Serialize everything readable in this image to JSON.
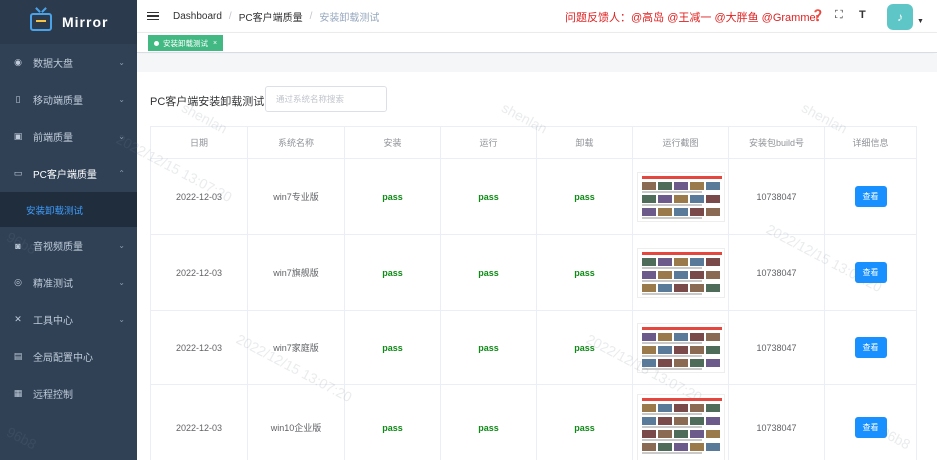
{
  "app": {
    "logo_text": "Mirror"
  },
  "sidebar": {
    "items": [
      {
        "label": "数据大盘",
        "icon": "dashboard-icon"
      },
      {
        "label": "移动端质量",
        "icon": "mobile-icon"
      },
      {
        "label": "前端质量",
        "icon": "frontend-icon"
      },
      {
        "label": "PC客户端质量",
        "icon": "desktop-icon"
      },
      {
        "label": "音视频质量",
        "icon": "camera-icon"
      },
      {
        "label": "精准测试",
        "icon": "target-icon"
      },
      {
        "label": "工具中心",
        "icon": "tools-icon"
      },
      {
        "label": "全局配置中心",
        "icon": "config-icon"
      },
      {
        "label": "远程控制",
        "icon": "remote-icon"
      }
    ],
    "submenu": {
      "label": "安装卸载测试"
    }
  },
  "header": {
    "breadcrumb": [
      "Dashboard",
      "PC客户端质量",
      "安装卸载测试"
    ],
    "feedback": "问题反馈人：@高岛 @王减一 @大胖鱼 @Grammer"
  },
  "tags": {
    "active": "安装卸载测试"
  },
  "main": {
    "title": "PC客户端安装卸载测试",
    "search_placeholder": "通过系统名称搜索",
    "columns": [
      "日期",
      "系统名称",
      "安装",
      "运行",
      "卸载",
      "运行截图",
      "安装包build号",
      "详细信息"
    ],
    "rows": [
      {
        "date": "2022-12-03",
        "system": "win7专业版",
        "install": "pass",
        "run": "pass",
        "uninstall": "pass",
        "build": "10738047",
        "action": "查看"
      },
      {
        "date": "2022-12-03",
        "system": "win7旗舰版",
        "install": "pass",
        "run": "pass",
        "uninstall": "pass",
        "build": "10738047",
        "action": "查看"
      },
      {
        "date": "2022-12-03",
        "system": "win7家庭版",
        "install": "pass",
        "run": "pass",
        "uninstall": "pass",
        "build": "10738047",
        "action": "查看"
      },
      {
        "date": "2022-12-03",
        "system": "win10企业版",
        "install": "pass",
        "run": "pass",
        "uninstall": "pass",
        "build": "10738047",
        "action": "查看"
      }
    ]
  },
  "watermark": {
    "date": "2022/12/15 13:07:20",
    "id": "96b8",
    "user": "shenlan"
  },
  "colors": {
    "sidebar_bg": "#304156",
    "accent": "#409eff",
    "button": "#1890ff",
    "pass": "#0e8a16",
    "feedback": "#e02020",
    "tag": "#42b983"
  }
}
